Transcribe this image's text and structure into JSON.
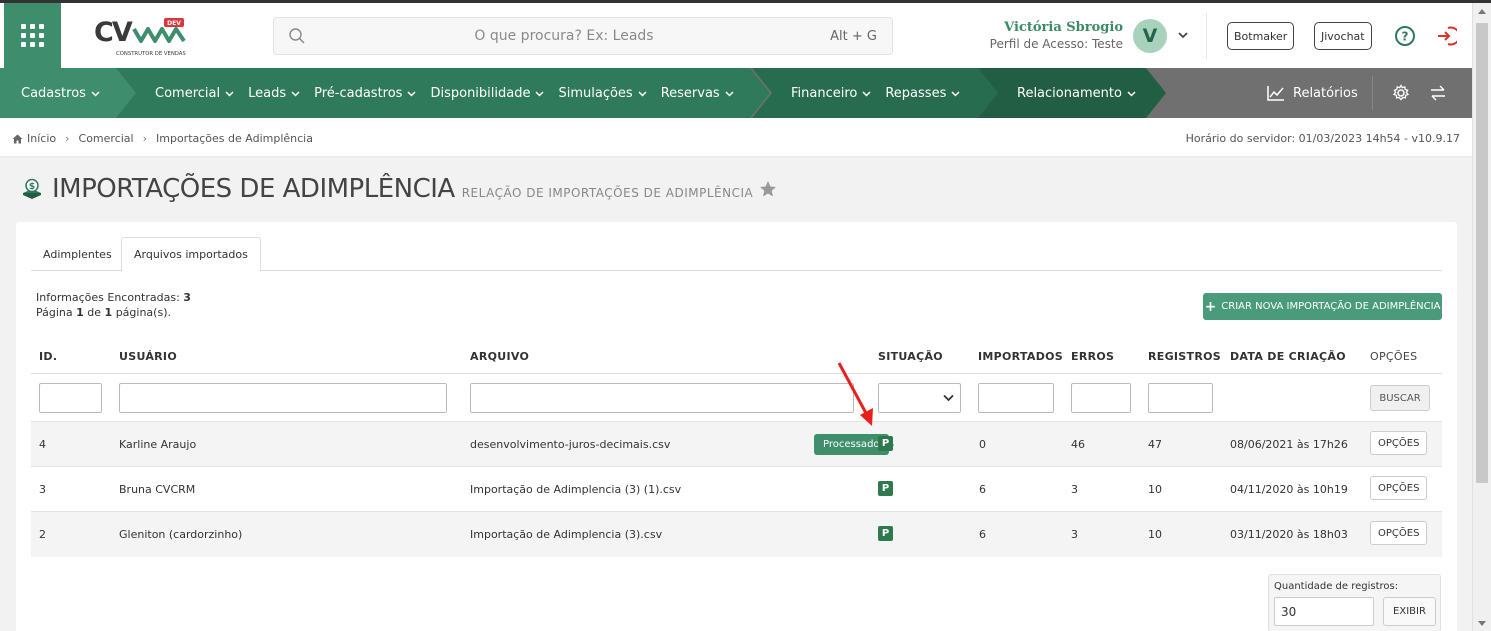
{
  "header": {
    "logo_text": "CV",
    "logo_badge": "DEV",
    "logo_tagline": "CONSTRUTOR DE VENDAS",
    "search_placeholder": "O que procura? Ex: Leads",
    "search_shortcut": "Alt + G",
    "user_name": "Victória Sbrogio",
    "user_profile": "Perfil de Acesso: Teste",
    "avatar_letter": "V",
    "botmaker_label": "Botmaker",
    "jivochat_label": "Jivochat"
  },
  "nav": {
    "groups": [
      {
        "color": "#3e8e6e",
        "items": [
          "Cadastros"
        ]
      },
      {
        "color": "#2f7a5a",
        "items": [
          "Comercial",
          "Leads",
          "Pré-cadastros",
          "Disponibilidade",
          "Simulações",
          "Reservas"
        ]
      },
      {
        "color": "#276c4f",
        "items": [
          "Financeiro",
          "Repasses"
        ]
      },
      {
        "color": "#215e44",
        "items": [
          "Relacionamento"
        ]
      }
    ],
    "reports_label": "Relatórios"
  },
  "breadcrumb": {
    "items": [
      "Início",
      "Comercial",
      "Importações de Adimplência"
    ],
    "server_time": "Horário do servidor: 01/03/2023 14h54 - v10.9.17"
  },
  "page": {
    "title": "IMPORTAÇÕES DE ADIMPLÊNCIA",
    "subtitle": "RELAÇÃO DE IMPORTAÇÕES DE ADIMPLÊNCIA"
  },
  "tabs": [
    "Adimplentes",
    "Arquivos importados"
  ],
  "info": {
    "found_label": "Informações Encontradas:",
    "found_count": "3",
    "page_prefix": "Página",
    "page_current": "1",
    "page_of": "de",
    "page_total": "1",
    "page_suffix": "página(s)."
  },
  "new_import_label": "CRIAR NOVA IMPORTAÇÃO DE ADIMPLÊNCIA",
  "table": {
    "headers": [
      "ID.",
      "USUÁRIO",
      "ARQUIVO",
      "SITUAÇÃO",
      "IMPORTADOS",
      "ERROS",
      "REGISTROS",
      "DATA DE CRIAÇÃO",
      "OPÇÕES"
    ],
    "search_button": "BUSCAR",
    "options_label": "OPÇÕES",
    "status_badge": "P",
    "tooltip": "Processado",
    "rows": [
      {
        "id": "4",
        "user": "Karline Araujo",
        "file": "desenvolvimento-juros-decimais.csv",
        "imported": "0",
        "errors": "46",
        "records": "47",
        "created": "08/06/2021 às 17h26"
      },
      {
        "id": "3",
        "user": "Bruna CVCRM",
        "file": "Importação de Adimplencia (3) (1).csv",
        "imported": "6",
        "errors": "3",
        "records": "10",
        "created": "04/11/2020 às 10h19"
      },
      {
        "id": "2",
        "user": "Gleniton (cardorzinho)",
        "file": "Importação de Adimplencia (3).csv",
        "imported": "6",
        "errors": "3",
        "records": "10",
        "created": "03/11/2020 às 18h03"
      }
    ]
  },
  "pagination": {
    "quantity_label": "Quantidade de registros:",
    "quantity_value": "30",
    "show_button": "EXIBIR"
  },
  "colors": {
    "accent": "#3e8e6e",
    "nav_gray": "#707070",
    "status_green": "#2e7a4e",
    "annotation_arrow": "#e8201c"
  }
}
